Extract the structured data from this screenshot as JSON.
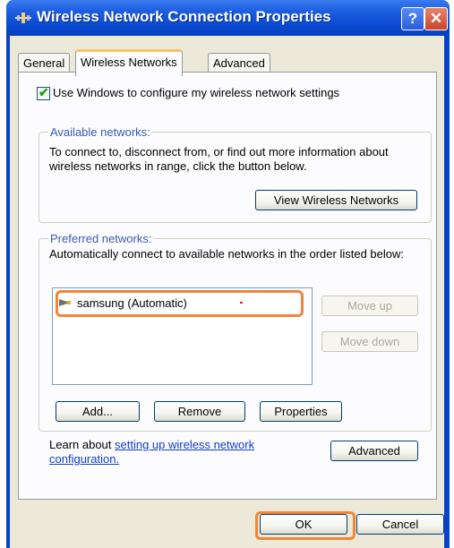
{
  "window": {
    "title": "Wireless Network Connection Properties",
    "help_symbol": "?",
    "close_symbol": "✕"
  },
  "tabs": [
    {
      "label": "General",
      "selected": false
    },
    {
      "label": "Wireless Networks",
      "selected": true
    },
    {
      "label": "Advanced",
      "selected": false
    }
  ],
  "settings": {
    "use_windows_label": "Use Windows to configure my wireless network settings",
    "use_windows_checked": true
  },
  "available": {
    "legend": "Available networks:",
    "description": "To connect to, disconnect from, or find out more information about wireless networks in range, click the button below.",
    "view_button": "View Wireless Networks"
  },
  "preferred": {
    "legend": "Preferred networks:",
    "description": "Automatically connect to available networks in the order listed below:",
    "networks": [
      {
        "name": "samsung (Automatic)"
      }
    ],
    "move_up": "Move up",
    "move_down": "Move down",
    "add": "Add...",
    "remove": "Remove",
    "properties": "Properties"
  },
  "learn": {
    "prefix": "Learn about ",
    "link_text": "setting up wireless network configuration.",
    "advanced_button": "Advanced"
  },
  "footer": {
    "ok": "OK",
    "cancel": "Cancel"
  },
  "colors": {
    "title_bar": "#0a4bd2",
    "dialog_bg": "#ece9d8",
    "highlight": "#f0863a",
    "link": "#0f3dcb",
    "legend": "#3a5ab4"
  },
  "icons": {
    "title": "network-connection-icon",
    "network": "wireless-network-icon"
  }
}
